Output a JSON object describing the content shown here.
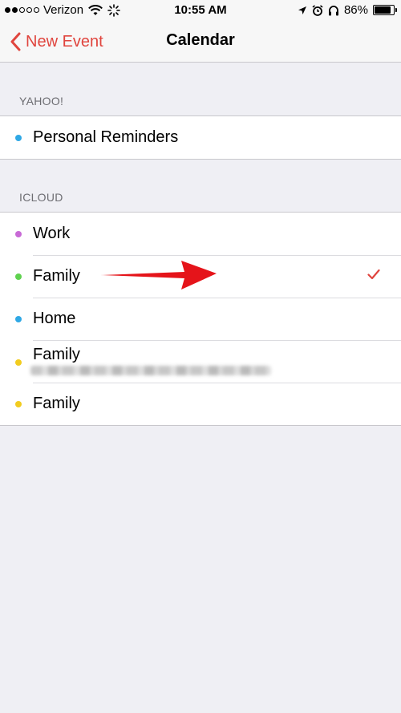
{
  "status_bar": {
    "carrier": "Verizon",
    "time": "10:55 AM",
    "battery": "86%",
    "battery_level": 0.86
  },
  "nav": {
    "back_label": "New Event",
    "title": "Calendar"
  },
  "sections": [
    {
      "header": "YAHOO!",
      "items": [
        {
          "label": "Personal Reminders",
          "color": "#2fa8e5"
        }
      ]
    },
    {
      "header": "ICLOUD",
      "items": [
        {
          "label": "Work",
          "color": "#c86ad6"
        },
        {
          "label": "Family",
          "color": "#5fd24f",
          "selected": true
        },
        {
          "label": "Home",
          "color": "#2fa8e5"
        },
        {
          "label": "Family",
          "color": "#f2cc1f",
          "subtitle_redacted": true
        },
        {
          "label": "Family",
          "color": "#f2cc1f"
        }
      ]
    }
  ],
  "colors": {
    "accent": "#e0453e",
    "annotation_arrow": "#e5141a"
  },
  "icons": [
    "chevron-left-icon",
    "wifi-icon",
    "activity-spinner-icon",
    "location-arrow-icon",
    "alarm-icon",
    "headphones-icon",
    "battery-icon",
    "checkmark-icon",
    "annotation-arrow"
  ]
}
